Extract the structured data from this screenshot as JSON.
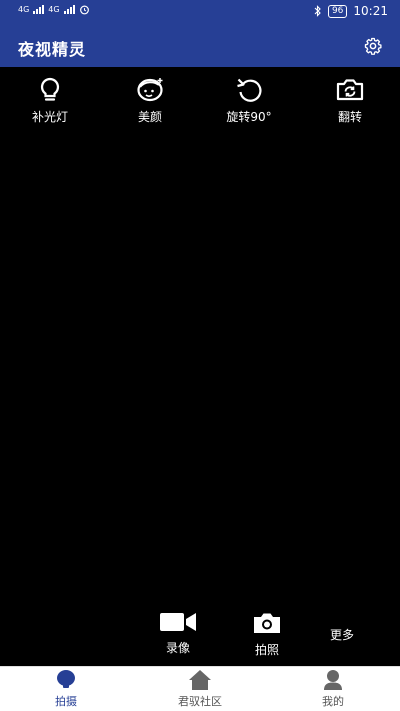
{
  "status_bar": {
    "network1": "4G",
    "network2": "4G",
    "battery": "96",
    "time": "10:21"
  },
  "app_bar": {
    "title": "夜视精灵",
    "settings_icon": "gear-icon"
  },
  "tools": [
    {
      "label": "补光灯",
      "icon": "bulb-icon"
    },
    {
      "label": "美颜",
      "icon": "beauty-face-icon"
    },
    {
      "label": "旋转90°",
      "icon": "rotate-icon"
    },
    {
      "label": "翻转",
      "icon": "flip-camera-icon"
    }
  ],
  "controls": {
    "record_label": "录像",
    "photo_label": "拍照",
    "more_label": "更多"
  },
  "tabs": [
    {
      "label": "拍摄",
      "icon": "shoot-tab-icon",
      "active": true
    },
    {
      "label": "君驭社区",
      "icon": "home-icon",
      "active": false
    },
    {
      "label": "我的",
      "icon": "profile-icon",
      "active": false
    }
  ],
  "colors": {
    "primary": "#263f95",
    "background": "#000000",
    "tab_inactive": "#666666"
  }
}
